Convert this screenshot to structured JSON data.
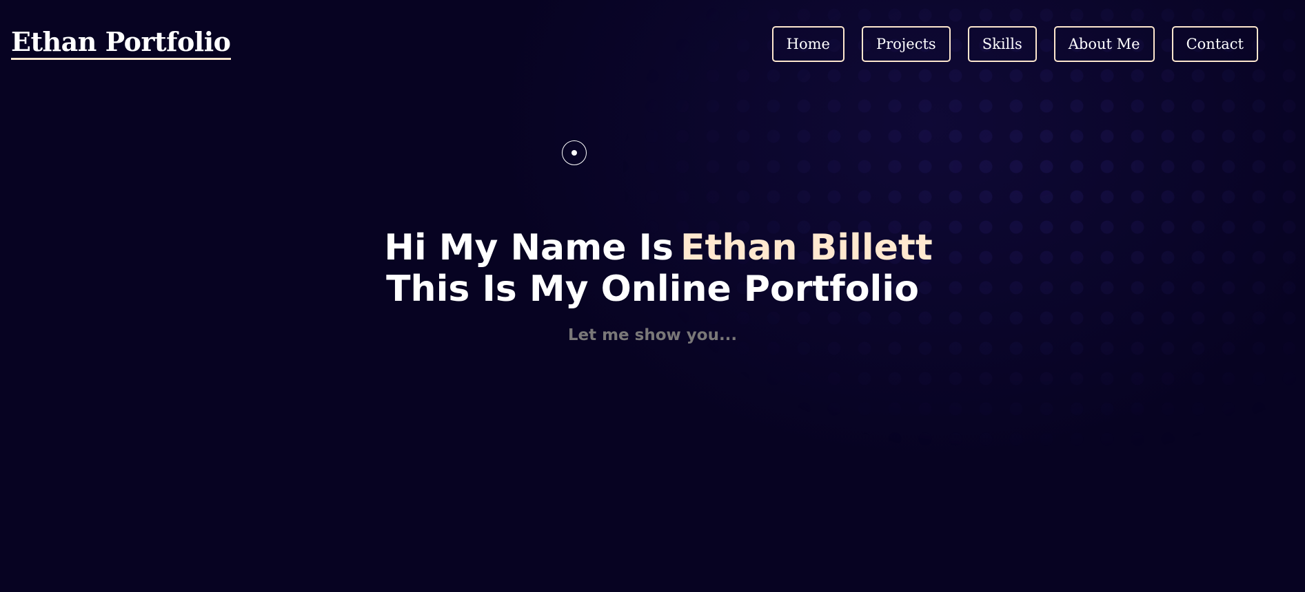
{
  "header": {
    "site_title": "Ethan Portfolio"
  },
  "nav": {
    "items": [
      {
        "label": "Home"
      },
      {
        "label": "Projects"
      },
      {
        "label": "Skills"
      },
      {
        "label": "About Me"
      },
      {
        "label": "Contact"
      }
    ]
  },
  "hero": {
    "intro": "Hi My Name Is",
    "name": "Ethan Billett",
    "line2": "This Is My Online Portfolio",
    "subtitle": "Let me show you..."
  },
  "colors": {
    "background": "#070322",
    "accent": "#ffe8cf",
    "text": "#ffffff",
    "subtitle": "#7a7878"
  },
  "icons": {
    "cursor": "custom-cursor-ring-icon"
  }
}
